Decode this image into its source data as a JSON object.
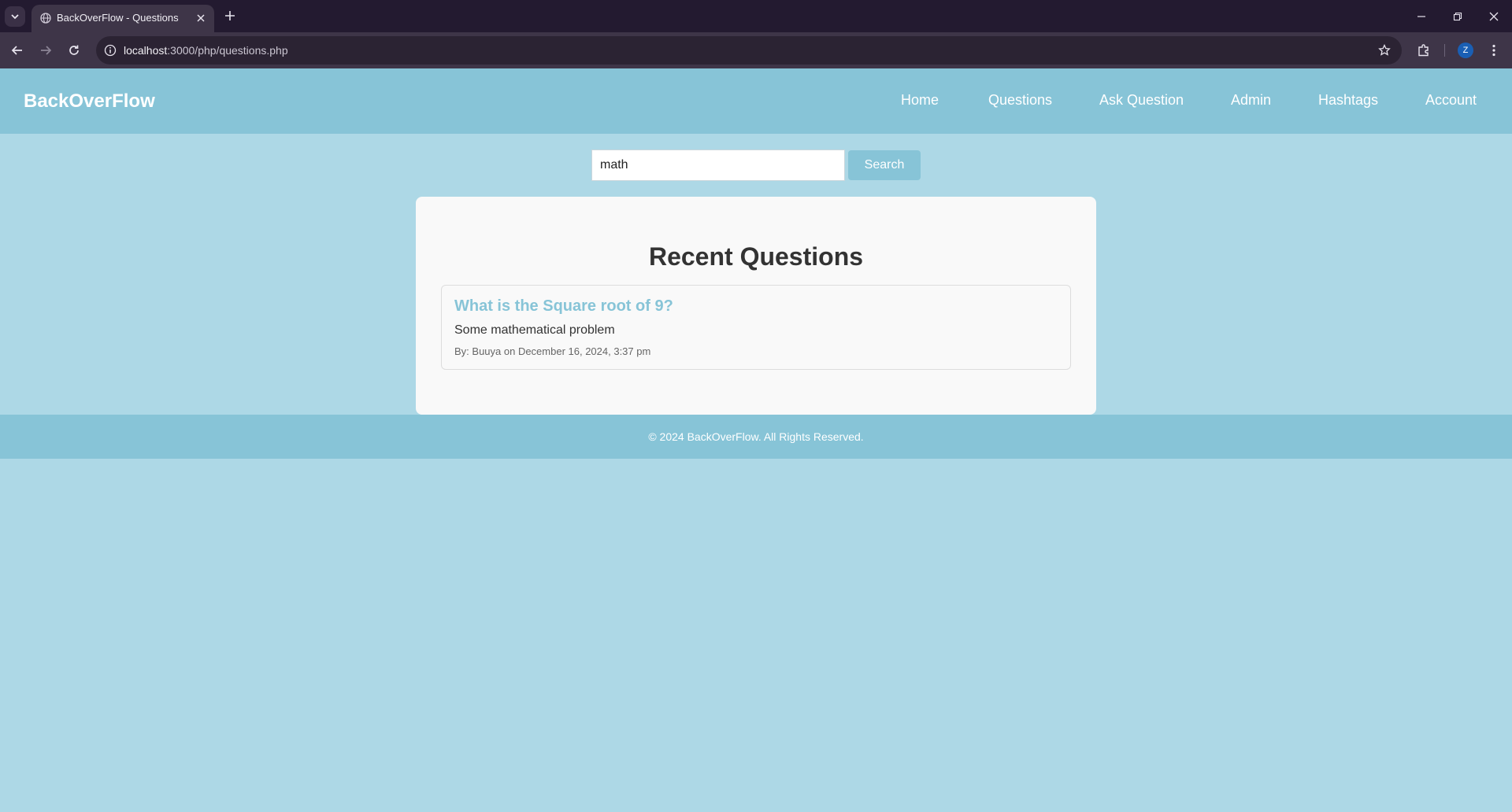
{
  "browser": {
    "tab_title": "BackOverFlow - Questions",
    "url_host": "localhost",
    "url_rest": ":3000/php/questions.php",
    "profile_initial": "Z",
    "icons": {
      "tab_list": "chevron-down-icon",
      "favicon": "globe-icon",
      "tab_close": "close-icon",
      "new_tab": "plus-icon",
      "back": "arrow-left-icon",
      "forward": "arrow-right-icon",
      "reload": "reload-icon",
      "site_info": "info-icon",
      "bookmark": "star-icon",
      "extensions": "puzzle-icon",
      "menu": "kebab-menu-icon",
      "minimize": "minimize-icon",
      "restore": "restore-icon",
      "close_window": "close-icon"
    }
  },
  "header": {
    "brand": "BackOverFlow",
    "nav": [
      {
        "label": "Home"
      },
      {
        "label": "Questions"
      },
      {
        "label": "Ask Question"
      },
      {
        "label": "Admin"
      },
      {
        "label": "Hashtags"
      },
      {
        "label": "Account"
      }
    ]
  },
  "search": {
    "value": "math",
    "button_label": "Search"
  },
  "main": {
    "title": "Recent Questions",
    "questions": [
      {
        "title": "What is the Square root of 9?",
        "body": "Some mathematical problem",
        "meta": "By: Buuya on December 16, 2024, 3:37 pm"
      }
    ]
  },
  "footer": {
    "text": "© 2024 BackOverFlow. All Rights Reserved."
  },
  "colors": {
    "page_bg": "#add8e6",
    "header_bg": "#87c4d7",
    "accent": "#87c4d7",
    "card_bg": "#f9f9f9",
    "browser_frame": "#231a30",
    "browser_toolbar": "#3e3548"
  }
}
